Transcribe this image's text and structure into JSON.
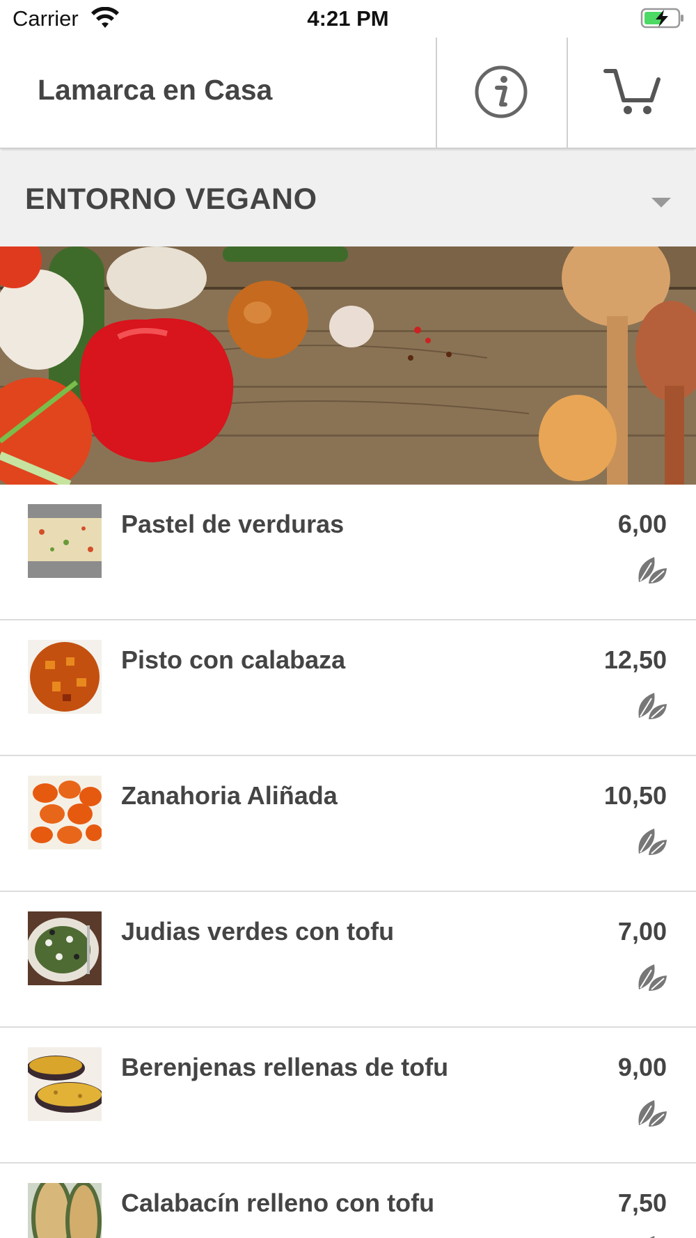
{
  "status_bar": {
    "carrier": "Carrier",
    "time": "4:21 PM",
    "wifi_icon": "wifi-icon",
    "battery_icon": "battery-charging-icon"
  },
  "header": {
    "title": "Lamarca en Casa",
    "info_icon": "info-icon",
    "cart_icon": "cart-icon"
  },
  "category": {
    "label": "ENTORNO VEGANO",
    "dropdown_icon": "chevron-down-icon"
  },
  "products": [
    {
      "name": "Pastel de verduras",
      "price": "6,00",
      "badge_icon": "leaf-icon"
    },
    {
      "name": "Pisto con calabaza",
      "price": "12,50",
      "badge_icon": "leaf-icon"
    },
    {
      "name": "Zanahoria Aliñada",
      "price": "10,50",
      "badge_icon": "leaf-icon"
    },
    {
      "name": "Judias verdes con tofu",
      "price": "7,00",
      "badge_icon": "leaf-icon"
    },
    {
      "name": "Berenjenas rellenas de tofu",
      "price": "9,00",
      "badge_icon": "leaf-icon"
    },
    {
      "name": "Calabacín relleno con tofu",
      "price": "7,50",
      "badge_icon": "leaf-icon"
    }
  ],
  "colors": {
    "text": "#444444",
    "header_bg": "#ffffff",
    "category_bg": "#f0f0f0",
    "divider": "#dcdcdc",
    "battery_charge": "#4cd964",
    "icon_gray": "#6b6b6b"
  }
}
